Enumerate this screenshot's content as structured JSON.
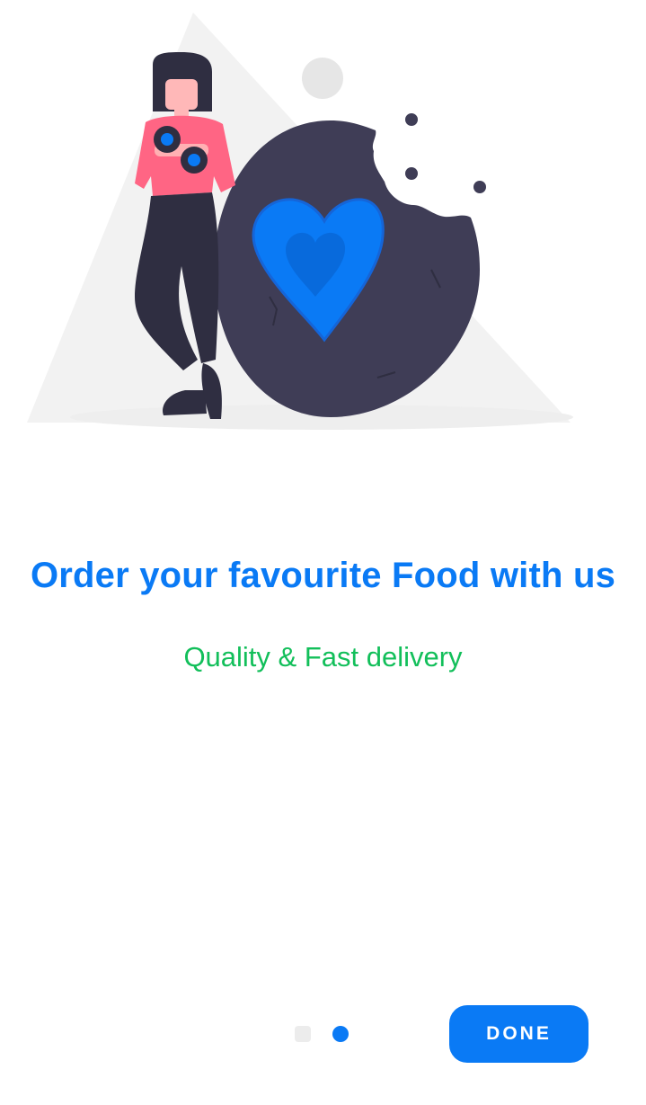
{
  "onboarding": {
    "title": "Order your favourite Food with us",
    "subtitle": "Quality & Fast delivery",
    "illustration_icon": "woman-with-cookie-heart-illustration",
    "page_indicator": {
      "total_pages": 2,
      "current_page": 2
    },
    "done_label": "DONE"
  },
  "colors": {
    "accent": "#0a7af5",
    "subtitle": "#12bf5a",
    "background": "#ffffff",
    "cookie": "#3f3d56",
    "shirt": "#ff6584",
    "triangle": "#f2f2f2"
  }
}
